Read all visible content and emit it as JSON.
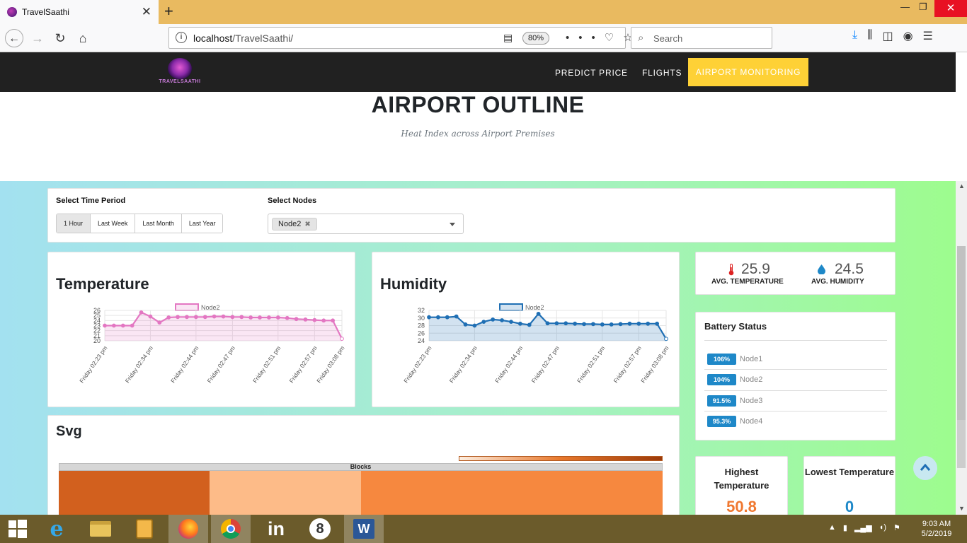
{
  "browser": {
    "tab_title": "TravelSaathi",
    "url_host": "localhost",
    "url_path": "/TravelSaathi/",
    "zoom": "80%",
    "search_placeholder": "Search"
  },
  "site": {
    "logo_text": "TRAVELSAATHI",
    "nav": [
      "PREDICT PRICE",
      "FLIGHTS",
      "AIRPORT MONITORING"
    ]
  },
  "page": {
    "title": "AIRPORT OUTLINE",
    "subtitle": "Heat Index across Airport Premises"
  },
  "filters": {
    "time_label": "Select Time Period",
    "time_options": [
      "1 Hour",
      "Last Week",
      "Last Month",
      "Last Year"
    ],
    "time_selected": "1 Hour",
    "nodes_label": "Select Nodes",
    "selected_node": "Node2"
  },
  "temperature": {
    "title": "Temperature"
  },
  "humidity": {
    "title": "Humidity"
  },
  "chart_data": [
    {
      "type": "line",
      "title": "Temperature",
      "series": [
        {
          "name": "Node2",
          "color": "#e377c2"
        }
      ],
      "x_ticks": [
        "Friday 02:23 pm",
        "Friday 02:34 pm",
        "Friday 02:44 pm",
        "Friday 02:47 pm",
        "Friday 02:51 pm",
        "Friday 02:57 pm",
        "Friday 03:08 pm"
      ],
      "y_ticks": [
        20,
        21,
        22,
        23,
        24,
        25,
        26
      ],
      "ylim": [
        20,
        26
      ],
      "values": [
        23,
        23,
        23,
        23,
        25.6,
        24.8,
        23.6,
        24.6,
        24.7,
        24.7,
        24.7,
        24.7,
        24.8,
        24.8,
        24.7,
        24.7,
        24.6,
        24.6,
        24.6,
        24.6,
        24.5,
        24.3,
        24.2,
        24.1,
        24.0,
        24.0,
        20.4
      ]
    },
    {
      "type": "line",
      "title": "Humidity",
      "series": [
        {
          "name": "Node2",
          "color": "#1f6fb4"
        }
      ],
      "x_ticks": [
        "Friday 02:23 pm",
        "Friday 02:34 pm",
        "Friday 02:44 pm",
        "Friday 02:47 pm",
        "Friday 02:51 pm",
        "Friday 02:57 pm",
        "Friday 03:08 pm"
      ],
      "y_ticks": [
        24,
        26,
        28,
        30,
        32
      ],
      "ylim": [
        24,
        32
      ],
      "values": [
        30.2,
        30.2,
        30.2,
        30.4,
        28.3,
        28.0,
        29.0,
        29.6,
        29.4,
        29.0,
        28.5,
        28.2,
        31.1,
        28.6,
        28.6,
        28.6,
        28.5,
        28.4,
        28.4,
        28.3,
        28.3,
        28.4,
        28.5,
        28.5,
        28.5,
        28.5,
        24.5
      ]
    }
  ],
  "averages": {
    "temperature_value": "25.9",
    "temperature_label": "AVG. TEMPERATURE",
    "humidity_value": "24.5",
    "humidity_label": "AVG. HUMIDITY"
  },
  "battery": {
    "title": "Battery Status",
    "items": [
      {
        "pct": "106%",
        "node": "Node1"
      },
      {
        "pct": "104%",
        "node": "Node2"
      },
      {
        "pct": "91.5%",
        "node": "Node3"
      },
      {
        "pct": "95.3%",
        "node": "Node4"
      }
    ]
  },
  "stats": {
    "highest_label": "Highest Temperature",
    "highest_value": "50.8",
    "highest_color": "#f07830",
    "lowest_label": "Lowest Temperature",
    "lowest_value": "0",
    "lowest_color": "#1e88c8"
  },
  "svg_panel": {
    "title": "Svg",
    "blocks_label": "Blocks",
    "block_colors": [
      "#d2601e",
      "#fdbb88",
      "#f6883f",
      "#f6883f"
    ]
  },
  "taskbar": {
    "time": "9:03 AM",
    "date": "5/2/2019"
  }
}
